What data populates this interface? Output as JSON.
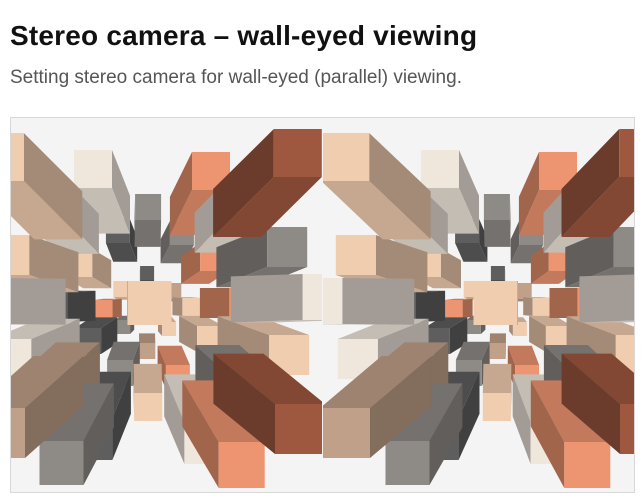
{
  "page": {
    "title": "Stereo camera – wall-eyed viewing",
    "subtitle": "Setting stereo camera for wall-eyed (parallel) viewing."
  },
  "scene": {
    "background": "#f4f4f4",
    "palette": {
      "cream": "#efe6dc",
      "peach": "#f1cdb0",
      "tan": "#c0a088",
      "grey": "#8e8a86",
      "dark": "#5e5e5e",
      "orange": "#ed9470",
      "rust": "#9e5840"
    },
    "icon": "stereo-pair-render"
  }
}
